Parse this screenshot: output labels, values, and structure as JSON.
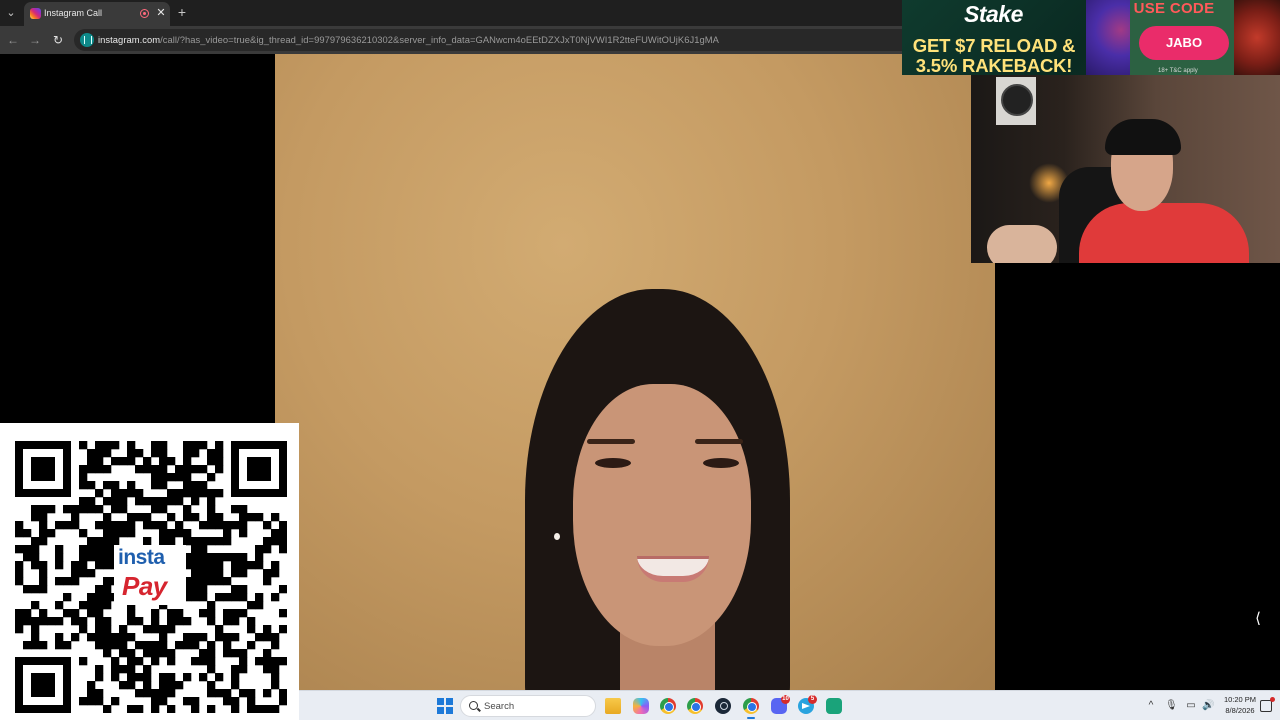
{
  "browser": {
    "tab_title": "Instagram Call",
    "tab_list_glyph": "⌄",
    "tab_close_glyph": "✕",
    "new_tab_glyph": "+",
    "url_host": "instagram.com",
    "url_path": "/call/?has_video=true&ig_thread_id=997979636210302&server_info_data=GANwcm4oEEtDZXJxT0NjVWI1R2tteFUWitOUjK6J1gMA",
    "back_glyph": "←",
    "forward_glyph": "→",
    "reload_glyph": "↻"
  },
  "call": {
    "toggle_glyph": "⟨"
  },
  "overlay": {
    "ad": {
      "brand": "Stake",
      "headline_line1": "GET $7 RELOAD &",
      "headline_line2": "3.5% RAKEBACK!",
      "use_code_label": "USE CODE",
      "code": "JABO",
      "terms": "18+  T&C apply"
    },
    "qr": {
      "brand_top": "insta",
      "brand_bottom": "Pay"
    }
  },
  "taskbar": {
    "search_placeholder": "Search",
    "time": "10:20 PM",
    "date": "8/8/2026",
    "tray_chevron": "^",
    "mic_glyph": "🎙",
    "network_glyph": "▭",
    "volume_glyph": "🔊",
    "badges": {
      "discord": "10",
      "telegram": "5"
    }
  },
  "colors": {
    "accent": "#1d79d8",
    "ad_code_button": "#ea2c6a",
    "ad_headline": "#ffe27a",
    "qr_brand_blue": "#1f5fae",
    "qr_brand_red": "#d6252f"
  }
}
